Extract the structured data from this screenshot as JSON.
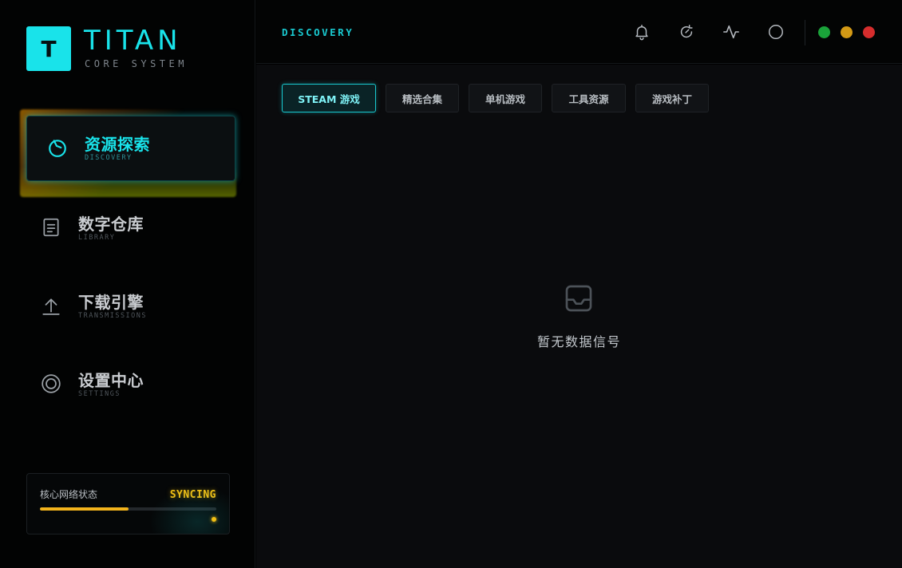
{
  "brand": {
    "logo_letter": "T",
    "title": "TITAN",
    "subtitle": "CORE SYSTEM"
  },
  "sidebar": {
    "items": [
      {
        "label": "资源探索",
        "sub": "DISCOVERY",
        "icon": "compass-icon",
        "active": true
      },
      {
        "label": "数字仓库",
        "sub": "LIBRARY",
        "icon": "document-icon",
        "active": false
      },
      {
        "label": "下载引擎",
        "sub": "TRANSMISSIONS",
        "icon": "upload-icon",
        "active": false
      },
      {
        "label": "设置中心",
        "sub": "SETTINGS",
        "icon": "target-icon",
        "active": false
      }
    ],
    "status": {
      "label": "核心网络状态",
      "value": "SYNCING",
      "progress": 0.5
    }
  },
  "header": {
    "title": "DISCOVERY",
    "icons": [
      "bell-icon",
      "refresh-icon",
      "activity-icon",
      "circle-icon"
    ]
  },
  "window_controls": {
    "colors": [
      "#1aa33a",
      "#d49a15",
      "#d62d2d"
    ]
  },
  "main": {
    "tabs": [
      {
        "label": "STEAM 游戏",
        "active": true
      },
      {
        "label": "精选合集",
        "active": false
      },
      {
        "label": "单机游戏",
        "active": false
      },
      {
        "label": "工具资源",
        "active": false
      },
      {
        "label": "游戏补丁",
        "active": false
      }
    ],
    "empty_state": {
      "icon": "inbox-icon",
      "text": "暂无数据信号"
    }
  },
  "colors": {
    "accent": "#19e3ea",
    "warning": "#f2c014",
    "background": "#0a0b0d"
  }
}
